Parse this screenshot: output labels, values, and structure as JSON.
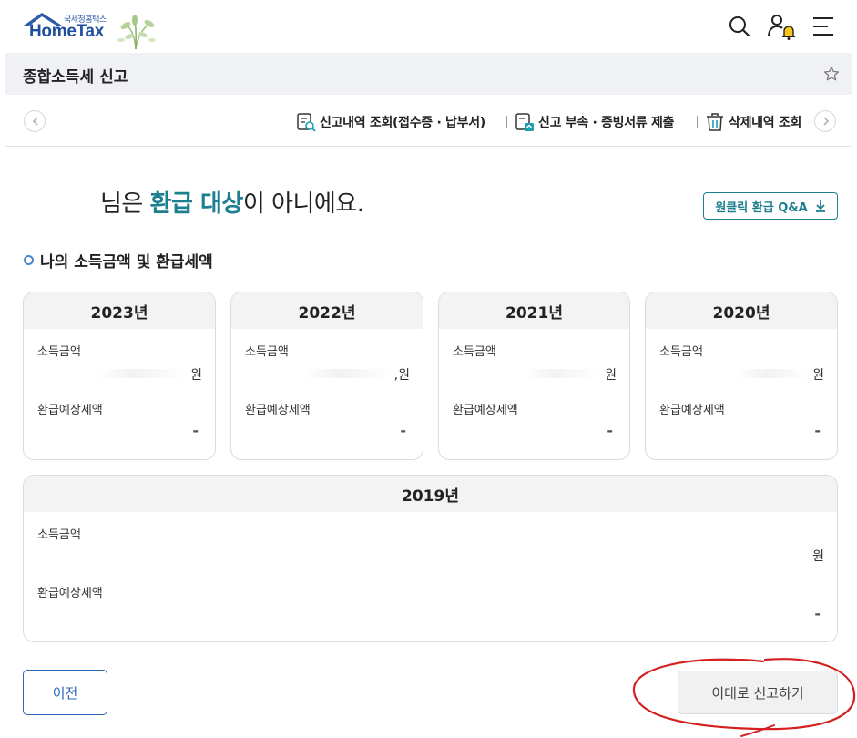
{
  "header": {
    "logo_small": "국세청홈택스",
    "logo_main": "HomeTax",
    "icons": [
      "search-icon",
      "user-bell-icon",
      "menu-icon"
    ]
  },
  "title_bar": {
    "title": "종합소득세 신고"
  },
  "sub_nav": {
    "items": [
      {
        "label": "신고내역 조회(접수증 · 납부서)",
        "icon": "document-search-icon"
      },
      {
        "label": "신고 부속 · 증빙서류 제출",
        "icon": "document-upload-icon"
      },
      {
        "label": "삭제내역 조회",
        "icon": "trash-icon"
      }
    ]
  },
  "headline": {
    "prefix": "님은 ",
    "highlight": "환급 대상",
    "suffix": "이 아니에요."
  },
  "qa_button": {
    "label": "원클릭 환급 Q&A"
  },
  "section_title": "나의 소득금액 및 환급세액",
  "years": [
    {
      "year": "2023년",
      "income_label": "소득금액",
      "income_unit": "원",
      "refund_label": "환급예상세액",
      "refund_value": "-"
    },
    {
      "year": "2022년",
      "income_label": "소득금액",
      "income_unit": ",원",
      "refund_label": "환급예상세액",
      "refund_value": "-"
    },
    {
      "year": "2021년",
      "income_label": "소득금액",
      "income_unit": "원",
      "refund_label": "환급예상세액",
      "refund_value": "-"
    },
    {
      "year": "2020년",
      "income_label": "소득금액",
      "income_unit": "원",
      "refund_label": "환급예상세액",
      "refund_value": "-"
    },
    {
      "year": "2019년",
      "income_label": "소득금액",
      "income_unit": "원",
      "refund_label": "환급예상세액",
      "refund_value": "-"
    }
  ],
  "buttons": {
    "prev": "이전",
    "submit": "이대로 신고하기"
  },
  "colors": {
    "accent_teal": "#1b7f8e",
    "brand_blue": "#1f4e9e",
    "annotation_red": "#d42020"
  }
}
